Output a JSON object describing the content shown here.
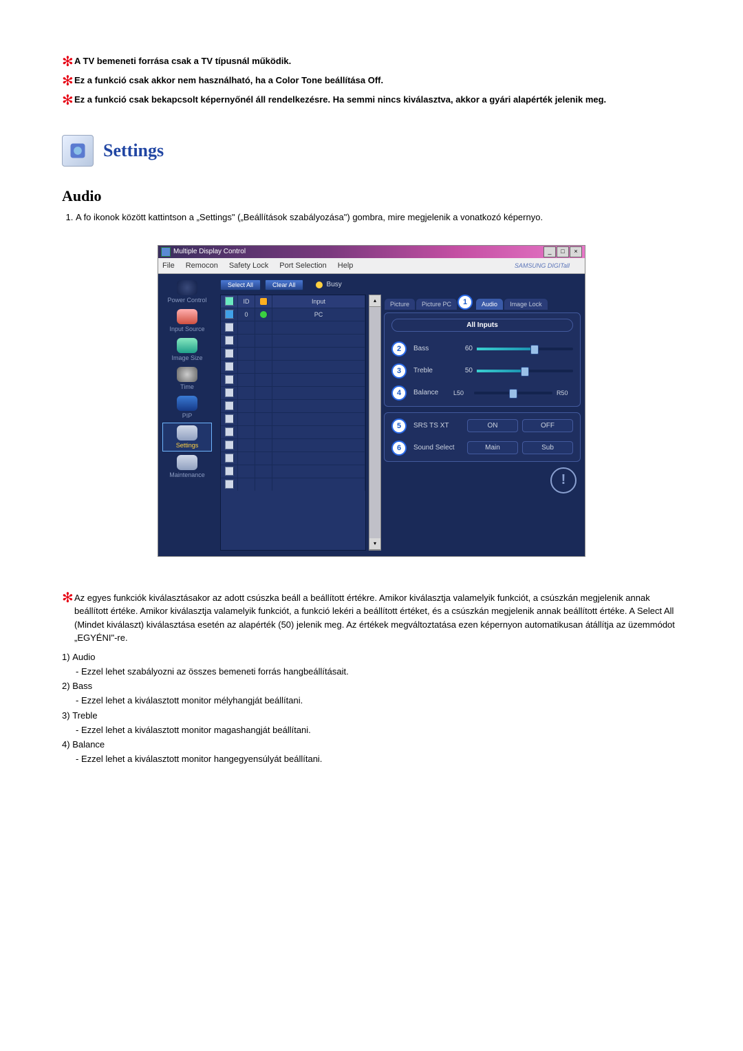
{
  "top_notes": [
    "A TV bemeneti forrása csak a TV típusnál működik.",
    "Ez a funkció csak akkor nem használható, ha a Color Tone beállítása Off.",
    "Ez a funkció csak bekapcsolt képernyőnél áll rendelkezésre. Ha semmi nincs kiválasztva, akkor a gyári alapérték jelenik meg."
  ],
  "section_title": "Settings",
  "sub_title": "Audio",
  "step_text": "A fo ikonok között kattintson a „Settings\" („Beállítások szabályozása\") gombra, mire megjelenik a vonatkozó képernyo.",
  "screenshot": {
    "window_title": "Multiple Display Control",
    "menu": {
      "file": "File",
      "remocon": "Remocon",
      "safety": "Safety Lock",
      "port": "Port Selection",
      "help": "Help"
    },
    "brand": "SAMSUNG DIGITall",
    "buttons": {
      "select_all": "Select All",
      "clear_all": "Clear All",
      "busy": "Busy"
    },
    "sidebar": [
      "Power Control",
      "Input Source",
      "Image Size",
      "Time",
      "PIP",
      "Settings",
      "Maintenance"
    ],
    "table": {
      "head_id": "ID",
      "head_input": "Input",
      "row_id": "0",
      "row_input": "PC"
    },
    "tabs": {
      "picture": "Picture",
      "picturepc": "Picture PC",
      "audio": "Audio",
      "imagelock": "Image Lock"
    },
    "panel": {
      "all": "All Inputs",
      "bass": {
        "label": "Bass",
        "value": "60"
      },
      "treble": {
        "label": "Treble",
        "value": "50"
      },
      "balance": {
        "label": "Balance",
        "left": "L50",
        "right": "R50"
      },
      "srs": {
        "label": "SRS TS XT",
        "on": "ON",
        "off": "OFF"
      },
      "sound": {
        "label": "Sound Select",
        "main": "Main",
        "sub": "Sub"
      }
    }
  },
  "mid_note": "Az egyes funkciók kiválasztásakor az adott csúszka beáll a beállított értékre. Amikor kiválasztja valamelyik funkciót, a csúszkán megjelenik annak beállított értéke. Amikor kiválasztja valamelyik funkciót, a funkció lekéri a beállított értéket, és a csúszkán megjelenik annak beállított értéke. A Select All (Mindet kiválaszt) kiválasztása esetén az alapérték (50) jelenik meg. Az értékek megváltoztatása ezen képernyon automatikusan átállítja az üzemmódot „EGYÉNI\"-re.",
  "desc": [
    {
      "n": "1)",
      "t": "Audio",
      "d": "- Ezzel lehet szabályozni az összes bemeneti forrás hangbeállításait."
    },
    {
      "n": "2)",
      "t": "Bass",
      "d": "- Ezzel lehet a kiválasztott monitor mélyhangját beállítani."
    },
    {
      "n": "3)",
      "t": "Treble",
      "d": "- Ezzel lehet a kiválasztott monitor magashangját beállítani."
    },
    {
      "n": "4)",
      "t": "Balance",
      "d": "- Ezzel lehet a kiválasztott monitor hangegyensúlyát beállítani."
    }
  ]
}
